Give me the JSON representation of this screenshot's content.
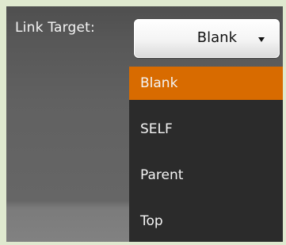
{
  "window": {
    "background": "#dfe9cf"
  },
  "link_target": {
    "label": "Link Target:",
    "selected_value": "Blank",
    "options": [
      {
        "label": "Blank",
        "selected": true
      },
      {
        "label": "SELF",
        "selected": false
      },
      {
        "label": "Parent",
        "selected": false
      },
      {
        "label": "Top",
        "selected": false
      }
    ],
    "icon": "chevron-down-icon"
  },
  "colors": {
    "accent": "#d86b00",
    "menu_background": "#2b2b2b",
    "panel_background": "#5b5b5b",
    "select_background": "#f2f2f2",
    "text_light": "#f4f4f4",
    "text_dark": "#111111"
  }
}
